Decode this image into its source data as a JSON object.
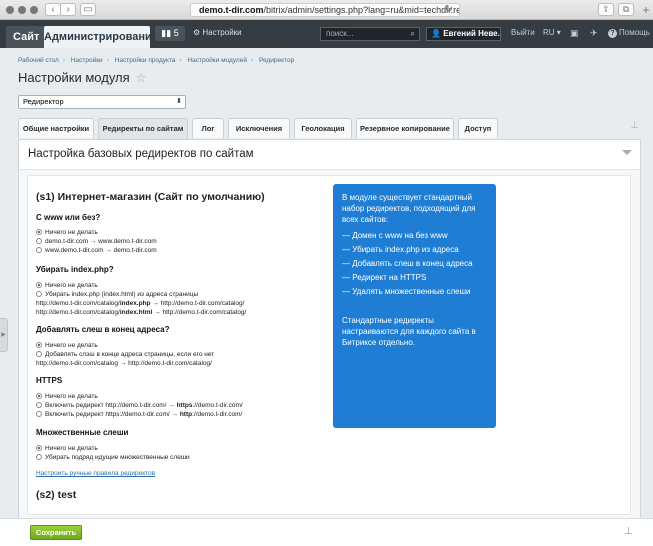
{
  "browser": {
    "url_domain": "demo.t-dir.com",
    "url_path": "/bitrix/admin/settings.php?lang=ru&mid=techdir.redirector&mi",
    "reload_icon": "reload-icon"
  },
  "admin_bar": {
    "site_tab": "Сайт",
    "admin_tab": "Администрирование",
    "notifications_count": "5",
    "settings_label": "Настройки",
    "search_placeholder": "поиск...",
    "user_name": "Евгений Неве...",
    "exit_label": "Выйти",
    "lang_label": "RU",
    "help_label": "Помощь"
  },
  "breadcrumb": [
    "Рабочий стол",
    "Настройки",
    "Настройки продукта",
    "Настройки модулей",
    "Редиректор"
  ],
  "page_title": "Настройки модуля",
  "module_select": {
    "value": "Редиректор"
  },
  "tabs": [
    {
      "label": "Общие настройки",
      "active": false
    },
    {
      "label": "Редиректы по сайтам",
      "active": true
    },
    {
      "label": "Лог",
      "active": false
    },
    {
      "label": "Исключения",
      "active": false
    },
    {
      "label": "Геолокация",
      "active": false
    },
    {
      "label": "Резервное копирование",
      "active": false
    },
    {
      "label": "Доступ",
      "active": false
    }
  ],
  "panel_title": "Настройка базовых редиректов по сайтам",
  "site1": {
    "heading": "(s1) Интернет-магазин (Сайт по умолчанию)",
    "www": {
      "title": "С www или без?",
      "options": [
        "Ничего не делать",
        "demo.t-dir.com → www.demo.t-dir.com",
        "www.demo.t-dir.com → demo.t-dir.com"
      ]
    },
    "index": {
      "title": "Убирать index.php?",
      "options": [
        "Ничего не делать",
        "Убирать index.php (index.html) из адреса страницы"
      ],
      "example1_pre": "http://demo.t-dir.com/catalog/",
      "example1_bold": "index.php",
      "example1_post": " → http://demo.t-dir.com/catalog/",
      "example2_pre": "http://demo.t-dir.com/catalog/",
      "example2_bold": "index.html",
      "example2_post": " → http://demo.t-dir.com/catalog/"
    },
    "slash": {
      "title": "Добавлять слеш в конец адреса?",
      "options": [
        "Ничего не делать",
        "Добавлять слэш в конце адреса страницы, если его нет"
      ],
      "example": "http://demo.t-dir.com/catalog → http://demo.t-dir.com/catalog/"
    },
    "https": {
      "title": "HTTPS",
      "options": [
        "Ничего не делать"
      ],
      "opt2_pre": "Включить редирект http://demo.t-dir.com/ → ",
      "opt2_bold": "https",
      "opt2_post": "://demo.t-dir.com/",
      "opt3_pre": "Включить редирект https://demo.t-dir.com/ → ",
      "opt3_bold": "http",
      "opt3_post": "://demo.t-dir.com/"
    },
    "multi": {
      "title": "Множественные слеши",
      "options": [
        "Ничего не делать",
        "Убирать подряд идущие множественные слеши"
      ]
    },
    "manual_link": "Настроить ручные правила редиректов"
  },
  "site2": {
    "heading": "(s2) test"
  },
  "info_box": {
    "intro": "В модуле существует стандартный набор редиректов, подходящий для всех сайтов:",
    "items": [
      "— Домен с www на без www",
      "— Убирать index.php из адреса",
      "— Добавлять слеш в конец адреса",
      "— Редирект на HTTPS",
      "— Удалять множественные слеши"
    ],
    "outro": "Стандартные редиректы настраиваются для каждого сайта в Битриксе отдельно."
  },
  "footer": {
    "save_label": "Сохранить"
  }
}
